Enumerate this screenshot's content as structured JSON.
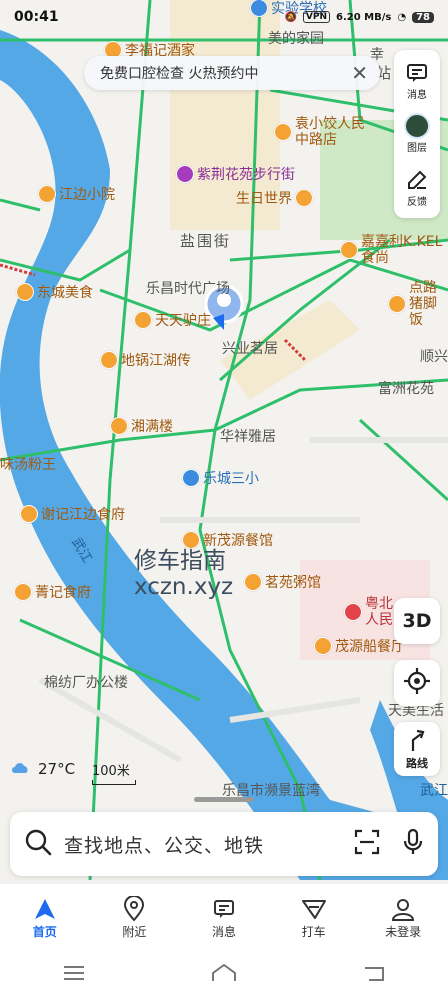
{
  "status": {
    "time": "00:41",
    "net": "VPN",
    "speed": "6.20 MB/s",
    "battery": "78"
  },
  "banner": {
    "text": "免费口腔检查 火热预约中",
    "close": "✕"
  },
  "tools": {
    "message": "消息",
    "layers": "图层",
    "feedback": "反馈"
  },
  "map_labels": {
    "streets": [
      "盐围街",
      "兴业茗居",
      "华祥雅居",
      "棉纺厂办公楼",
      "富洲花苑",
      "顺兴",
      "美的家园",
      "乐昌时代广场",
      "乐昌市濒景蓝湾",
      "武江",
      "天美生活",
      "站",
      "幸"
    ],
    "pois": [
      {
        "name": "李福记酒家"
      },
      {
        "name": "袁小饺人民中路店"
      },
      {
        "name": "紫荆花苑步行街"
      },
      {
        "name": "生日世界"
      },
      {
        "name": "江边小院"
      },
      {
        "name": "嘉嘉利K.KEL食尚"
      },
      {
        "name": "东城美食"
      },
      {
        "name": "点路猪脚饭"
      },
      {
        "name": "天天驴庄"
      },
      {
        "name": "地锅江湖传"
      },
      {
        "name": "湘满楼"
      },
      {
        "name": "乐城三小"
      },
      {
        "name": "味汤粉王"
      },
      {
        "name": "谢记江边食府"
      },
      {
        "name": "新茂源餐馆"
      },
      {
        "name": "茗苑粥馆"
      },
      {
        "name": "菁记食府"
      },
      {
        "name": "粤北人民"
      },
      {
        "name": "茂源船餐厅"
      },
      {
        "name": "实验学校"
      }
    ],
    "river": "武江"
  },
  "watermark": {
    "line1": "修车指南",
    "line2": "xczn.xyz"
  },
  "controls": {
    "three_d": "3D",
    "route": "路线"
  },
  "weather": {
    "temp": "27°C"
  },
  "scale": {
    "text": "100米"
  },
  "search": {
    "placeholder": "查找地点、公交、地铁"
  },
  "tabs": [
    {
      "label": "首页"
    },
    {
      "label": "附近"
    },
    {
      "label": "消息"
    },
    {
      "label": "打车"
    },
    {
      "label": "未登录"
    }
  ],
  "colors": {
    "accent": "#1d6cf0",
    "road": "#2fbf6a",
    "river": "#55a8e6",
    "poi": "#f3a233"
  }
}
